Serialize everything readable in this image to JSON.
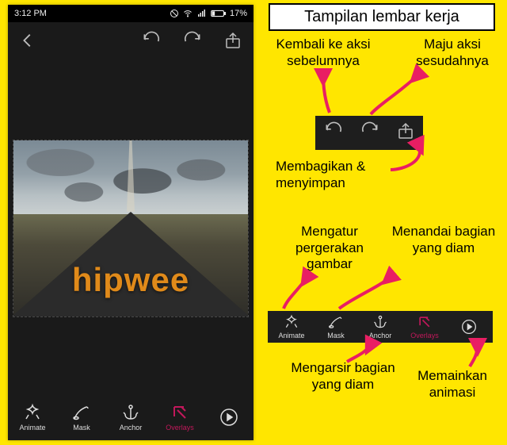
{
  "status": {
    "time": "3:12 PM",
    "battery": "17%"
  },
  "watermark": "hipwee",
  "tools": {
    "animate": "Animate",
    "mask": "Mask",
    "anchor": "Anchor",
    "overlays": "Overlays"
  },
  "right": {
    "title": "Tampilan lembar kerja",
    "undo": "Kembali ke aksi sebelumnya",
    "redo": "Maju aksi sesudahnya",
    "share": "Membagikan & menyimpan",
    "animate": "Mengatur pergerakan gambar",
    "mask": "Menandai bagian yang diam",
    "anchor": "Mengarsir bagian yang diam",
    "play": "Memainkan animasi"
  }
}
